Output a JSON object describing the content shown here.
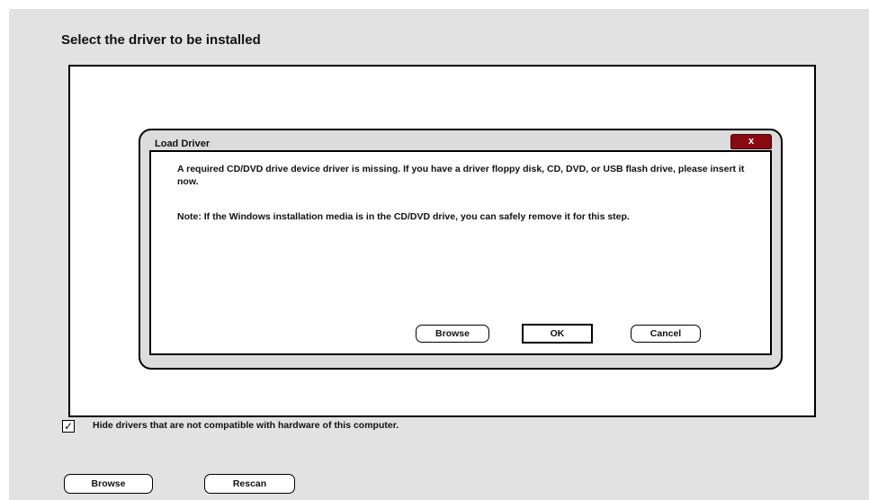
{
  "page": {
    "title": "Select the driver to be installed"
  },
  "dialog": {
    "title": "Load Driver",
    "close_label": "x",
    "message": "A required CD/DVD drive device driver is missing. If you have a driver floppy disk, CD, DVD, or USB flash drive, please insert it now.",
    "note": "Note:  If the Windows installation media is in the CD/DVD drive, you can safely remove it for this step.",
    "buttons": {
      "browse": "Browse",
      "ok": "OK",
      "cancel": "Cancel"
    }
  },
  "options": {
    "hide_incompatible_checked": true,
    "hide_incompatible_label": "Hide drivers that are not compatible with hardware of this computer.",
    "check_mark": "✓"
  },
  "footer": {
    "browse_label": "Browse",
    "rescan_label": "Rescan"
  }
}
